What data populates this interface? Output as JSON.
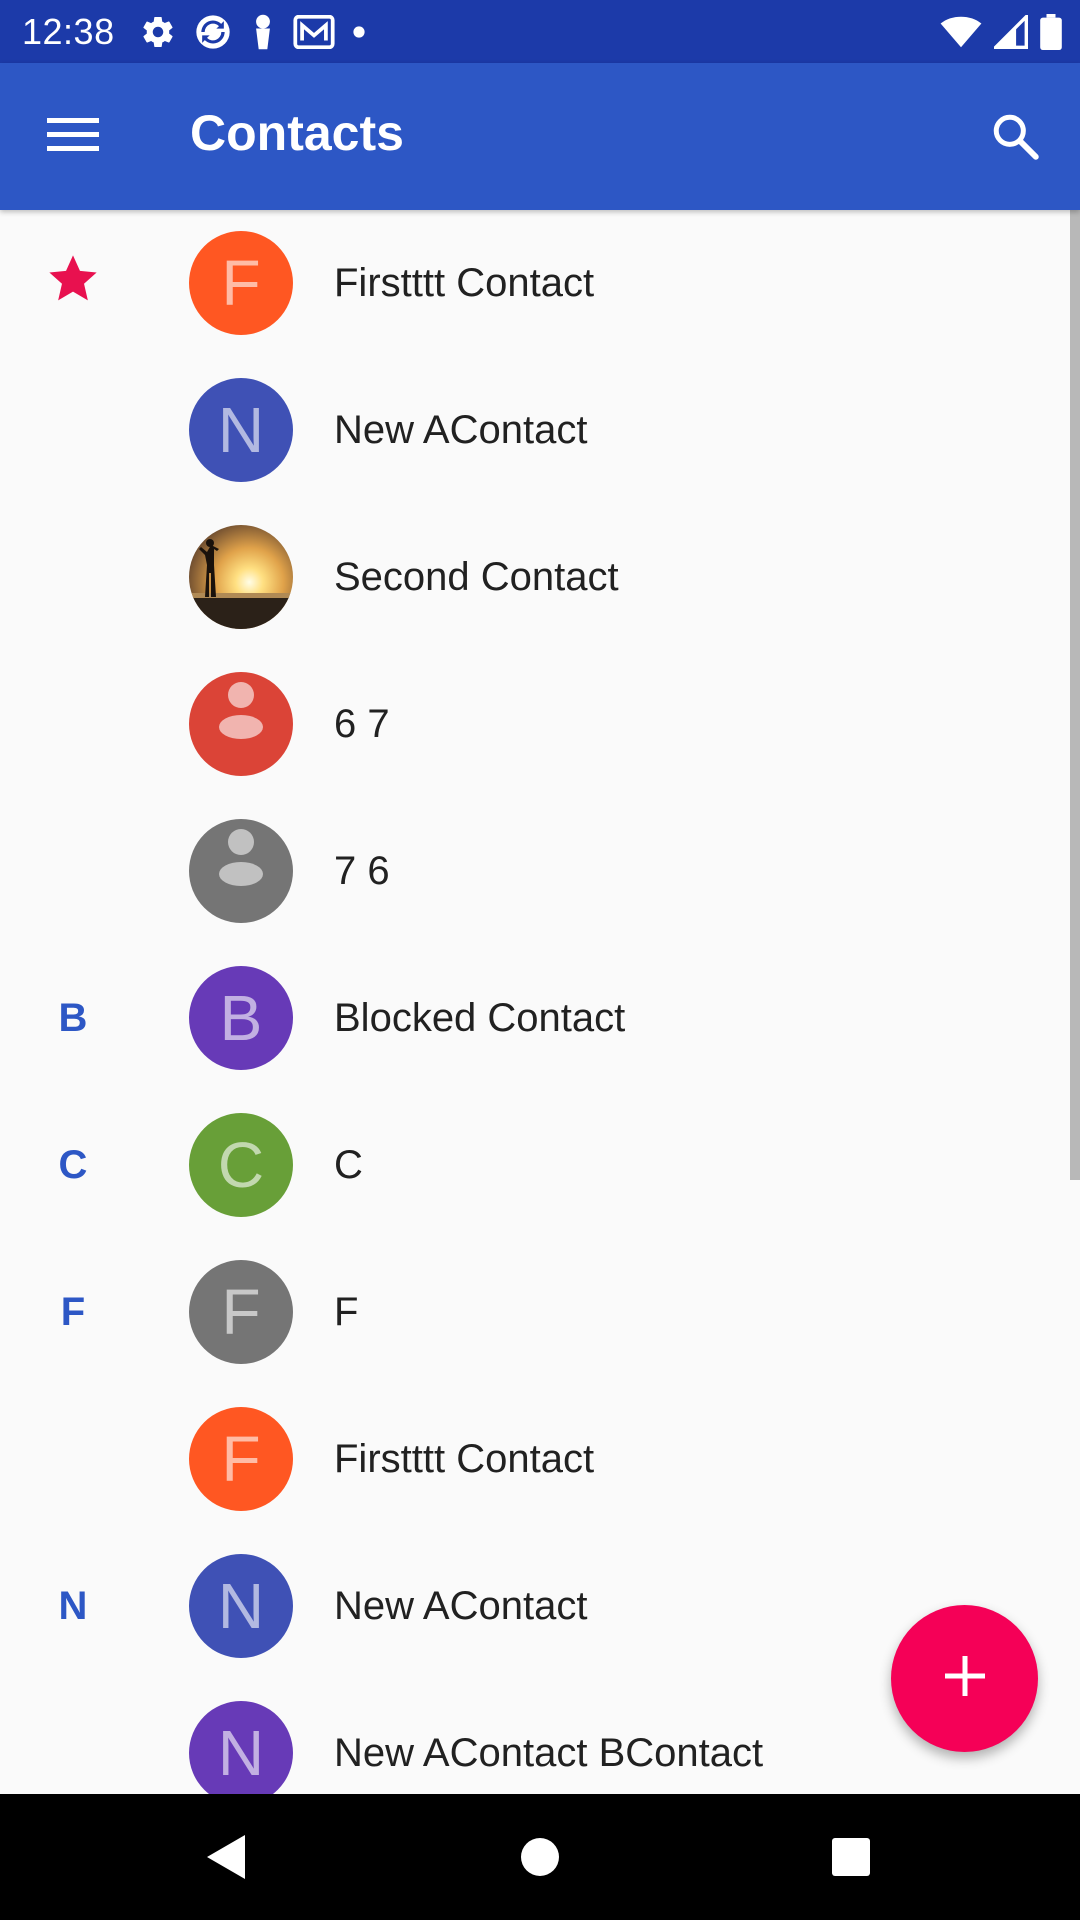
{
  "status_bar": {
    "time": "12:38",
    "left_icons": [
      "settings-icon",
      "sync-icon",
      "key-icon",
      "mail-icon",
      "dot-icon"
    ],
    "right_icons": [
      "wifi-icon",
      "cell-signal-icon",
      "battery-icon"
    ]
  },
  "app_bar": {
    "title": "Contacts",
    "menu_icon": "menu-icon",
    "search_icon": "search-icon"
  },
  "colors": {
    "status_bar": "#1c3aa9",
    "app_bar": "#2d57c5",
    "accent": "#f50057",
    "header_letter": "#2d57c5"
  },
  "contacts": [
    {
      "header": "",
      "header_icon": "star-icon",
      "name": "Firstttt Contact",
      "avatar_type": "letter",
      "avatar_letter": "F",
      "avatar_color": "#ff5722"
    },
    {
      "header": "",
      "header_icon": "",
      "name": "New AContact",
      "avatar_type": "letter",
      "avatar_letter": "N",
      "avatar_color": "#3f51b5"
    },
    {
      "header": "",
      "header_icon": "",
      "name": "Second Contact",
      "avatar_type": "photo",
      "avatar_letter": "",
      "avatar_color": ""
    },
    {
      "header": "",
      "header_icon": "",
      "name": "6 7",
      "avatar_type": "person",
      "avatar_letter": "",
      "avatar_color": "#db4437"
    },
    {
      "header": "",
      "header_icon": "",
      "name": "7 6",
      "avatar_type": "person",
      "avatar_letter": "",
      "avatar_color": "#757575"
    },
    {
      "header": "B",
      "header_icon": "",
      "name": "Blocked Contact",
      "avatar_type": "letter",
      "avatar_letter": "B",
      "avatar_color": "#673ab7"
    },
    {
      "header": "C",
      "header_icon": "",
      "name": "C",
      "avatar_type": "letter",
      "avatar_letter": "C",
      "avatar_color": "#689f38"
    },
    {
      "header": "F",
      "header_icon": "",
      "name": "F",
      "avatar_type": "letter",
      "avatar_letter": "F",
      "avatar_color": "#757575"
    },
    {
      "header": "",
      "header_icon": "",
      "name": "Firstttt Contact",
      "avatar_type": "letter",
      "avatar_letter": "F",
      "avatar_color": "#ff5722"
    },
    {
      "header": "N",
      "header_icon": "",
      "name": "New AContact",
      "avatar_type": "letter",
      "avatar_letter": "N",
      "avatar_color": "#3f51b5"
    },
    {
      "header": "",
      "header_icon": "",
      "name": "New AContact BContact",
      "avatar_type": "letter",
      "avatar_letter": "N",
      "avatar_color": "#673ab7"
    }
  ],
  "fab": {
    "icon": "plus-icon"
  },
  "nav_bar": {
    "buttons": [
      "back-icon",
      "home-icon",
      "recents-icon"
    ]
  }
}
